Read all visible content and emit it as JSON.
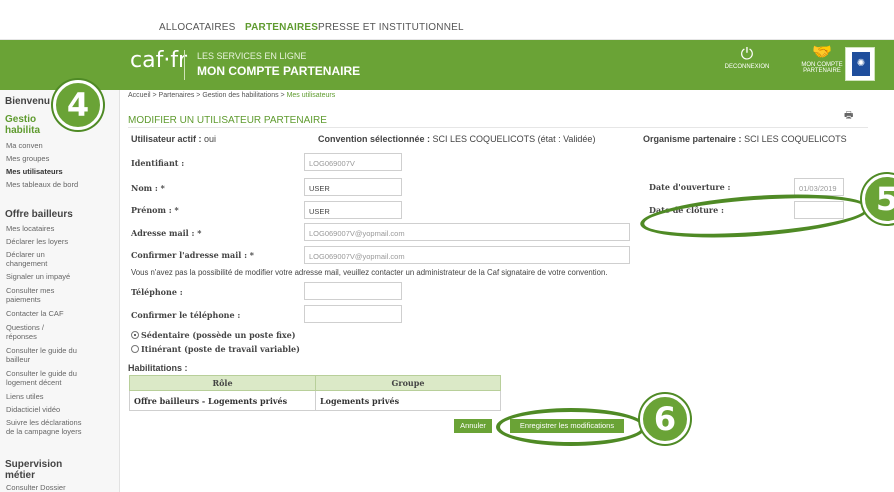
{
  "topnav": {
    "tabs": [
      {
        "label": "ALLOCATAIRES"
      },
      {
        "label": "PARTENAIRES"
      },
      {
        "label": "PRESSE ET INSTITUTIONNEL"
      }
    ]
  },
  "banner": {
    "logo": "caf·fr",
    "service_line1": "LES SERVICES EN LIGNE",
    "service_line2": "MON COMPTE PARTENAIRE",
    "logout_label": "DECONNEXION",
    "account_label_1": "MON COMPTE",
    "account_label_2": "PARTENAIRE"
  },
  "sidebar": {
    "welcome": "Bienvenu",
    "gestion_head_1": "Gestio",
    "gestion_head_2": "habilita",
    "items_gestion": [
      {
        "label": "Ma conven"
      },
      {
        "label": "Mes groupes"
      },
      {
        "label": "Mes utilisateurs"
      },
      {
        "label": "Mes tableaux de bord"
      }
    ],
    "offre_head": "Offre bailleurs",
    "items_offre": [
      {
        "label": "Mes locataires"
      },
      {
        "label": "Déclarer les loyers"
      },
      {
        "label": "Déclarer un changement"
      },
      {
        "label": "Signaler un impayé"
      },
      {
        "label": "Consulter mes paiements"
      },
      {
        "label": "Contacter la CAF"
      },
      {
        "label": "Questions / réponses"
      },
      {
        "label": "Consulter le guide du bailleur"
      },
      {
        "label": "Consulter le guide du logement décent"
      },
      {
        "label": "Liens utiles"
      },
      {
        "label": "Didacticiel vidéo"
      },
      {
        "label": "Suivre les déclarations de la campagne loyers"
      }
    ],
    "supervision_head": "Supervision métier",
    "items_supervision": [
      {
        "label": "Consulter Dossier"
      }
    ]
  },
  "breadcrumb": {
    "path": "Accueil > Partenaires > Gestion des habilitations > ",
    "current": "Mes utilisateurs"
  },
  "page_title": "MODIFIER UN UTILISATEUR PARTENAIRE",
  "summary": {
    "active_label": "Utilisateur actif :",
    "active_value": "oui",
    "convention_label": "Convention sélectionnée :",
    "convention_value": "SCI LES COQUELICOTS (état : Validée)",
    "organisme_label": "Organisme partenaire :",
    "organisme_value": "SCI LES COQUELICOTS"
  },
  "form": {
    "identifiant_label": "Identifiant :",
    "identifiant_value": "LOG069007V",
    "nom_label": "Nom : *",
    "nom_value": "USER",
    "prenom_label": "Prénom : *",
    "prenom_value": "USER",
    "email_label": "Adresse mail : *",
    "email_value": "LOG069007V@yopmail.com",
    "email_confirm_label": "Confirmer l'adresse mail : *",
    "email_confirm_value": "LOG069007V@yopmail.com",
    "note": "Vous n'avez pas la possibilité de modifier votre adresse mail, veuillez contacter un administrateur de la Caf signataire de votre convention.",
    "phone_label": "Téléphone :",
    "phone_value": "",
    "phone_confirm_label": "Confirmer le téléphone :",
    "phone_confirm_value": "",
    "opening_label": "Date d'ouverture :",
    "opening_value": "01/03/2019",
    "closing_label": "Date de clôture :",
    "closing_value": "",
    "radio_sedentaire": "Sédentaire (possède un poste fixe)",
    "radio_itinerant": "Itinérant (poste de travail variable)"
  },
  "habilitations": {
    "title": "Habilitations :",
    "headers": [
      "Rôle",
      "Groupe"
    ],
    "rows": [
      [
        "Offre bailleurs - Logements privés",
        "Logements privés"
      ]
    ]
  },
  "actions": {
    "cancel_label": "Annuler",
    "save_label": "Enregistrer les modifications"
  },
  "annotations": {
    "step4": "4",
    "step5": "5",
    "step6": "6"
  },
  "colors": {
    "brand_green": "#6aa336",
    "annotation_green": "#4f8a25",
    "table_header": "#dbe9c7"
  }
}
